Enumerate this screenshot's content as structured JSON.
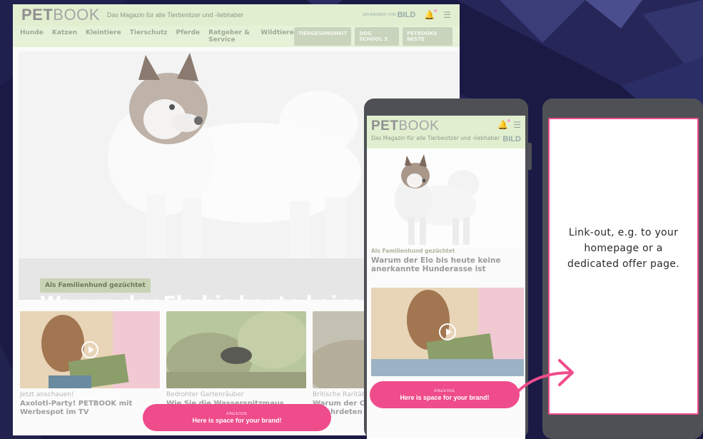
{
  "brand": {
    "pet": "PET",
    "book": "BOOK"
  },
  "desktop": {
    "tagline": "Das Magazin für alle Tierbesitzer und -liebhaber",
    "bild": {
      "small": "EIN ANGEBOT VON",
      "name": "BILD"
    },
    "nav": [
      "Hunde",
      "Katzen",
      "Kleintiere",
      "Tierschutz",
      "Pferde",
      "Ratgeber & Service",
      "Wildtiere"
    ],
    "pills": [
      "TIERGESUNDHEIT",
      "DOG SCHOOL 3",
      "PETBOOKS BESTE"
    ],
    "hero": {
      "label": "Als Familienhund gezüchtet",
      "title": "Warum der Elo bis heute keine anerkannte Hunderasse ist"
    },
    "cards": [
      {
        "kicker": "Jetzt anschauen!",
        "title": "Axolotl-Party! PETBOOK mit Werbespot im TV",
        "video": true
      },
      {
        "kicker": "Bedrohter Gartenräuber",
        "title": "Wie Sie die Wasserspitzmaus erkennen",
        "video": false
      },
      {
        "kicker": "Britische Rarität",
        "title": "Warum der Clumber Spaniel gefährdeten Hunderassen",
        "video": false
      }
    ]
  },
  "ad": {
    "label": "ANZEIGE",
    "text": "Here is space for your brand!"
  },
  "mobile": {
    "tagline": "Das Magazin für alle Tierbesitzer und -liebhaber",
    "bild": "BILD",
    "hero_label": "Als Familienhund gezüchtet",
    "hero_title": "Warum der Elo bis heute keine anerkannte Hunderasse ist"
  },
  "linkout": {
    "text": "Link-out, e.g. to your homepage or a dedicated offer page."
  },
  "colors": {
    "background": "#1a1a45",
    "accent_pink": "#ef4c8c",
    "header_green": "#e1efd0",
    "phone_frame": "#4f5056"
  },
  "icons": [
    "bell-icon",
    "menu-icon",
    "play-icon",
    "arrow-right-icon"
  ]
}
